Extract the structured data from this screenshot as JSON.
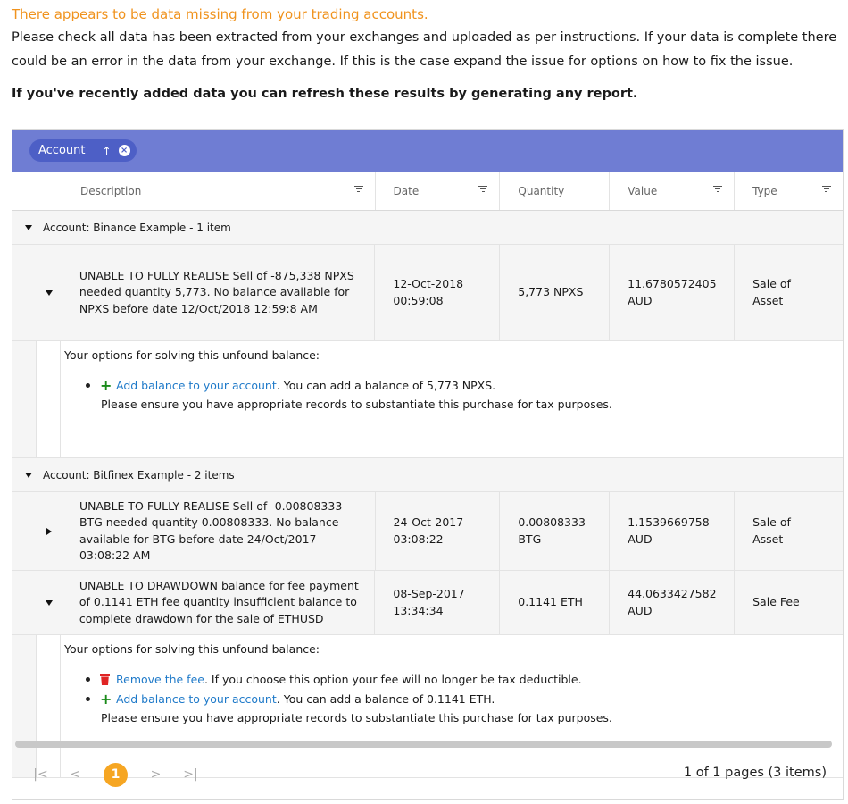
{
  "notice": {
    "warning": "There appears to be data missing from your trading accounts.",
    "message": "Please check all data has been extracted from your exchanges and uploaded as per instructions. If your data is complete there could be an error in the data from your exchange. If this is the case expand the issue for options on how to fix the issue.",
    "refresh": "If you've recently added data you can refresh these results by generating any report."
  },
  "grouping": {
    "chip_label": "Account",
    "sort_symbol": "↑",
    "remove_symbol": "×"
  },
  "columns": [
    "Description",
    "Date",
    "Quantity",
    "Value",
    "Type"
  ],
  "groups": [
    {
      "label": "Account: Binance Example - 1 item",
      "rows": [
        {
          "description": "UNABLE TO FULLY REALISE Sell of -875,338 NPXS needed quantity 5,773. No balance available for NPXS before date 12/Oct/2018 12:59:8 AM",
          "date": "12-Oct-2018 00:59:08",
          "quantity": "5,773 NPXS",
          "value": "11.6780572405 AUD",
          "type": "Sale of Asset"
        }
      ],
      "detail": {
        "heading": "Your options for solving this unfound balance:",
        "add_link": "Add balance to your account",
        "add_text": ". You can add a balance of 5,773 NPXS.",
        "note": "Please ensure you have appropriate records to substantiate this purchase for tax purposes."
      }
    },
    {
      "label": "Account: Bitfinex Example - 2 items",
      "rows": [
        {
          "description": "UNABLE TO FULLY REALISE Sell of -0.00808333 BTG needed quantity 0.00808333. No balance available for BTG before date 24/Oct/2017 03:08:22 AM",
          "date": "24-Oct-2017 03:08:22",
          "quantity": "0.00808333 BTG",
          "value": "1.1539669758 AUD",
          "type": "Sale of Asset"
        },
        {
          "description": "UNABLE TO DRAWDOWN balance for fee payment of 0.1141 ETH fee quantity insufficient balance to complete drawdown for the sale of ETHUSD",
          "date": "08-Sep-2017 13:34:34",
          "quantity": "0.1141 ETH",
          "value": "44.0633427582 AUD",
          "type": "Sale Fee"
        }
      ],
      "detail": {
        "heading": "Your options for solving this unfound balance:",
        "remove_link": "Remove the fee",
        "remove_text": ". If you choose this option your fee will no longer be tax deductible.",
        "add_link": "Add balance to your account",
        "add_text": ". You can add a balance of 0.1141 ETH.",
        "note": "Please ensure you have appropriate records to substantiate this purchase for tax purposes."
      }
    }
  ],
  "pager": {
    "first": "|<",
    "prev": "<",
    "current": "1",
    "next": ">",
    "last": ">|",
    "info": "1 of 1 pages (3 items)"
  },
  "colors": {
    "warning": "#f0931e",
    "header": "#6f7dd3",
    "link": "#1f7ac9",
    "page": "#f6a623"
  }
}
